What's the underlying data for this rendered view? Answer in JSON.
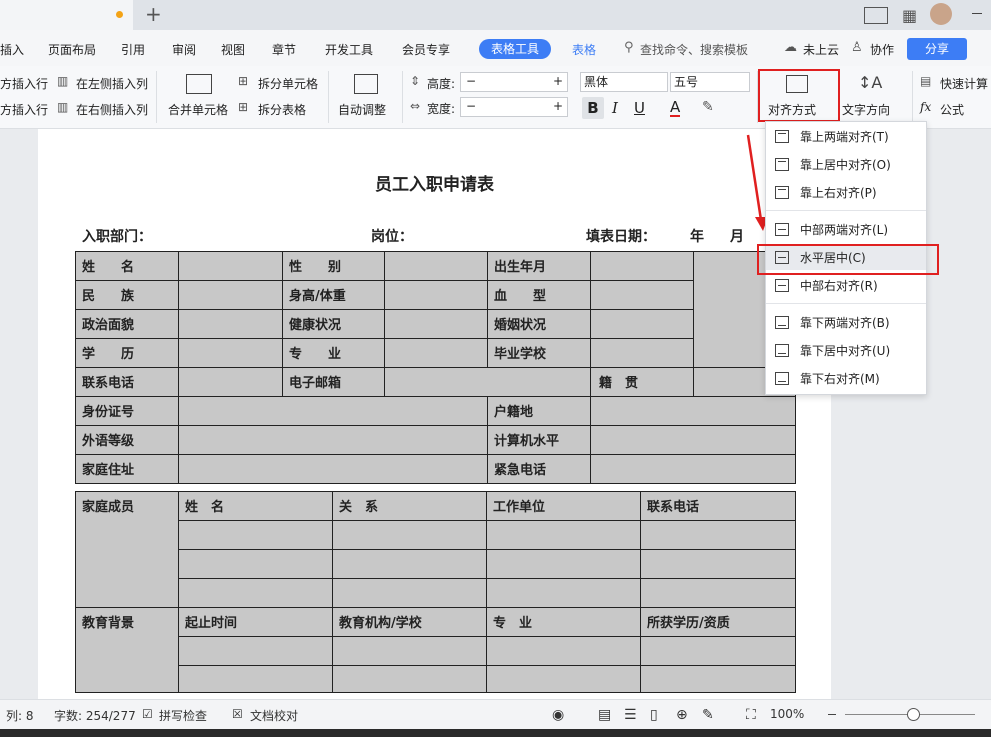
{
  "titlebar": {
    "plus": "+"
  },
  "menus": [
    "插入",
    "页面布局",
    "引用",
    "审阅",
    "视图",
    "章节",
    "开发工具",
    "会员专享"
  ],
  "menu_active": "表格工具",
  "menu_next": "表格",
  "search_placeholder": "查找命令、搜索模板",
  "cloud": "未上云",
  "collab": "协作",
  "share": "分享",
  "ribbon": {
    "insert_above": "方插入行",
    "insert_below": "方插入行",
    "insert_left": "在左侧插入列",
    "insert_right": "在右侧插入列",
    "merge": "合并单元格",
    "split_cell": "拆分单元格",
    "split_table": "拆分表格",
    "auto_adjust": "自动调整",
    "height_label": "高度:",
    "width_label": "宽度:",
    "minus": "−",
    "plus": "+",
    "font": "黑体",
    "size": "五号",
    "bold": "B",
    "italic": "I",
    "underline": "U",
    "fontcolor": "A",
    "align": "对齐方式",
    "text_dir": "文字方向",
    "quick_calc": "快速计算",
    "formula": "公式"
  },
  "doc": {
    "title": "员工入职申请表",
    "dept": "入职部门：",
    "position": "岗位：",
    "date": "填表日期：",
    "year": "年",
    "month": "月"
  },
  "rows": [
    [
      "姓　　名",
      "",
      "性　　别",
      "",
      "出生年月",
      ""
    ],
    [
      "民　　族",
      "",
      "身高/体重",
      "",
      "血　　型",
      ""
    ],
    [
      "政治面貌",
      "",
      "健康状况",
      "",
      "婚姻状况",
      ""
    ],
    [
      "学　　历",
      "",
      "专　　业",
      "",
      "毕业学校",
      ""
    ],
    [
      "联系电话",
      "",
      "电子邮箱",
      "",
      "籍　贯",
      ""
    ]
  ],
  "rows2": [
    [
      "身份证号",
      "",
      "户籍地",
      ""
    ],
    [
      "外语等级",
      "",
      "计算机水平",
      ""
    ],
    [
      "家庭住址",
      "",
      "紧急电话",
      ""
    ]
  ],
  "family": {
    "label": "家庭成员",
    "cols": [
      "姓　名",
      "关　系",
      "工作单位",
      "联系电话"
    ]
  },
  "edu": {
    "label": "教育背景",
    "cols": [
      "起止时间",
      "教育机构/学校",
      "专　业",
      "所获学历/资质"
    ]
  },
  "dropdown": [
    "靠上两端对齐(T)",
    "靠上居中对齐(O)",
    "靠上右对齐(P)",
    "中部两端对齐(L)",
    "水平居中(C)",
    "中部右对齐(R)",
    "靠下两端对齐(B)",
    "靠下居中对齐(U)",
    "靠下右对齐(M)"
  ],
  "status": {
    "col": "列: 8",
    "words": "字数: 254/277",
    "spell": "拼写检查",
    "proof": "文档校对",
    "zoom": "100%"
  },
  "colors": {
    "accent": "#3d7df5",
    "highlight": "#e02020",
    "cell": "#c8c8c8"
  }
}
